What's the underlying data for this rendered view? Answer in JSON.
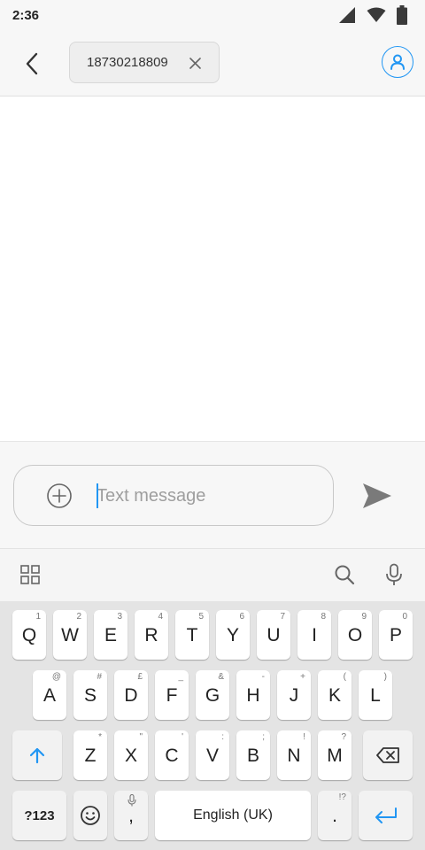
{
  "status_bar": {
    "time": "2:36",
    "icons": [
      "signal-icon",
      "wifi-icon",
      "battery-icon"
    ]
  },
  "header": {
    "recipient": "18730218809"
  },
  "compose": {
    "placeholder": "Text message"
  },
  "keyboard": {
    "row1": [
      {
        "label": "Q",
        "hint": "1"
      },
      {
        "label": "W",
        "hint": "2"
      },
      {
        "label": "E",
        "hint": "3"
      },
      {
        "label": "R",
        "hint": "4"
      },
      {
        "label": "T",
        "hint": "5"
      },
      {
        "label": "Y",
        "hint": "6"
      },
      {
        "label": "U",
        "hint": "7"
      },
      {
        "label": "I",
        "hint": "8"
      },
      {
        "label": "O",
        "hint": "9"
      },
      {
        "label": "P",
        "hint": "0"
      }
    ],
    "row2": [
      {
        "label": "A",
        "hint": "@"
      },
      {
        "label": "S",
        "hint": "#"
      },
      {
        "label": "D",
        "hint": "£"
      },
      {
        "label": "F",
        "hint": "_"
      },
      {
        "label": "G",
        "hint": "&"
      },
      {
        "label": "H",
        "hint": "-"
      },
      {
        "label": "J",
        "hint": "+"
      },
      {
        "label": "K",
        "hint": "("
      },
      {
        "label": "L",
        "hint": ")"
      }
    ],
    "row3": [
      {
        "label": "Z",
        "hint": "*"
      },
      {
        "label": "X",
        "hint": "\""
      },
      {
        "label": "C",
        "hint": "'"
      },
      {
        "label": "V",
        "hint": ":"
      },
      {
        "label": "B",
        "hint": ";"
      },
      {
        "label": "N",
        "hint": "!"
      },
      {
        "label": "M",
        "hint": "?"
      }
    ],
    "symbols_label": "?123",
    "comma_label": ",",
    "space_label": "English (UK)",
    "period_label": ".",
    "period_hint": "!?"
  },
  "colors": {
    "accent": "#2196f3",
    "background": "#f7f7f7",
    "keyboard_bg": "#e4e4e4"
  }
}
